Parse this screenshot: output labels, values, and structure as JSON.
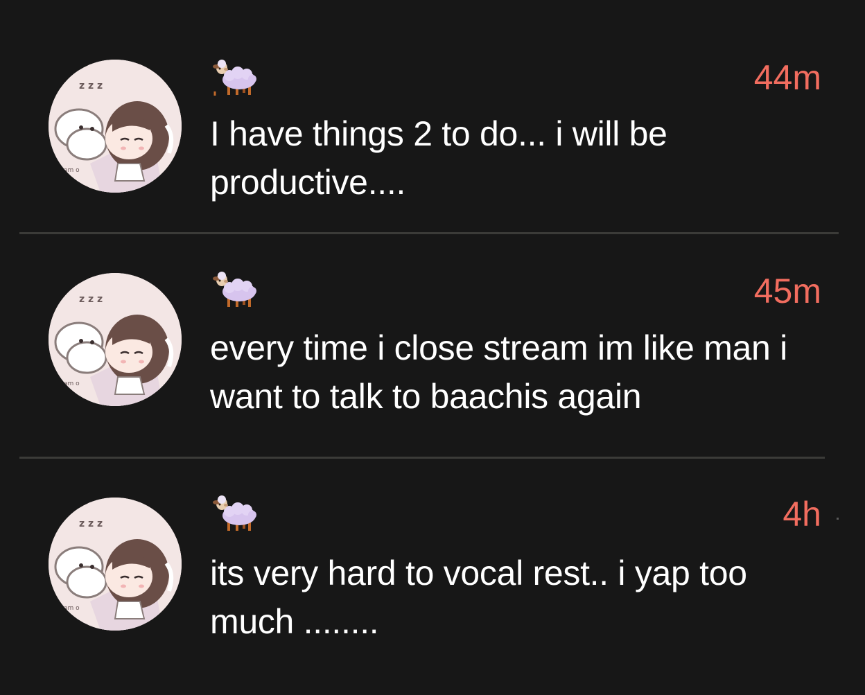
{
  "colors": {
    "background": "#171717",
    "timestamp": "#f26d5f",
    "text": "#ffffff",
    "divider": "#3b3b38"
  },
  "posts": [
    {
      "avatar_icon": "sleeping-girl-avatar",
      "badge_icon": "sheep-icon",
      "time": "44m",
      "text": "I have things 2 to do... i will be productive...."
    },
    {
      "avatar_icon": "sleeping-girl-avatar",
      "badge_icon": "sheep-icon",
      "time": "45m",
      "text": "every time i close stream im like man i want to talk to baachis again"
    },
    {
      "avatar_icon": "sleeping-girl-avatar",
      "badge_icon": "sheep-icon",
      "time": "4h",
      "text": "its very hard to vocal rest.. i yap too much ........"
    }
  ]
}
